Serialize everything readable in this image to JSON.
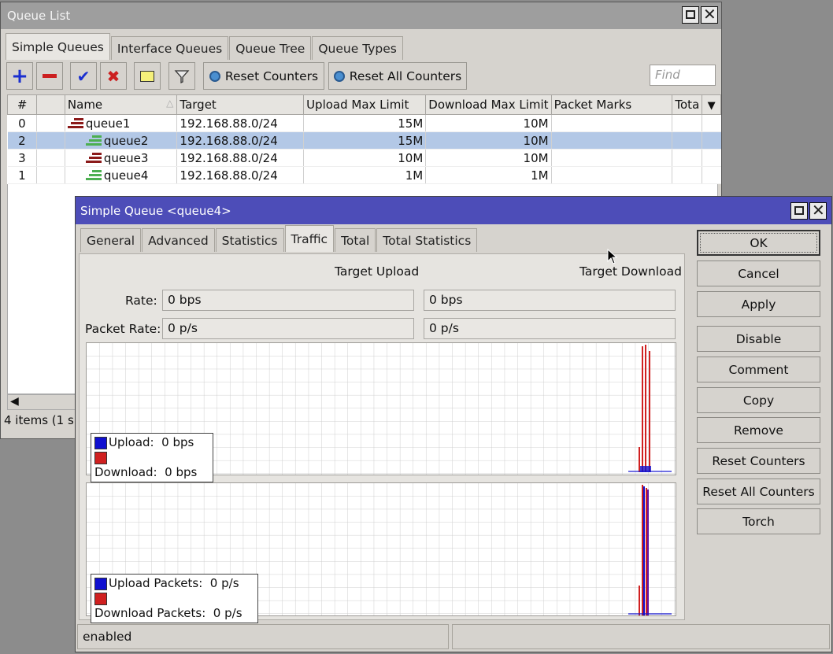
{
  "queue_list": {
    "title": "Queue List",
    "tabs": [
      "Simple Queues",
      "Interface Queues",
      "Queue Tree",
      "Queue Types"
    ],
    "active_tab": 0,
    "toolbar": {
      "reset_counters": "Reset Counters",
      "reset_all_counters": "Reset All Counters",
      "find_placeholder": "Find"
    },
    "columns": [
      "#",
      "",
      "Name",
      "Target",
      "Upload Max Limit",
      "Download Max Limit",
      "Packet Marks",
      "Tota"
    ],
    "rows": [
      {
        "num": "0",
        "name": "queue1",
        "target": "192.168.88.0/24",
        "upload": "15M",
        "download": "10M",
        "icon_color": "#8b1a1a",
        "indent": 0
      },
      {
        "num": "2",
        "name": "queue2",
        "target": "192.168.88.0/24",
        "upload": "15M",
        "download": "10M",
        "icon_color": "#4caf50",
        "indent": 1
      },
      {
        "num": "3",
        "name": "queue3",
        "target": "192.168.88.0/24",
        "upload": "10M",
        "download": "10M",
        "icon_color": "#8b1a1a",
        "indent": 1
      },
      {
        "num": "1",
        "name": "queue4",
        "target": "192.168.88.0/24",
        "upload": "1M",
        "download": "1M",
        "icon_color": "#4caf50",
        "indent": 1
      }
    ],
    "status": "4 items (1 s"
  },
  "simple_queue": {
    "title": "Simple Queue <queue4>",
    "tabs": [
      "General",
      "Advanced",
      "Statistics",
      "Traffic",
      "Total",
      "Total Statistics"
    ],
    "active_tab": 3,
    "col_upload": "Target Upload",
    "col_download": "Target Download",
    "rate_label": "Rate:",
    "rate_upload": "0 bps",
    "rate_download": "0 bps",
    "packet_rate_label": "Packet Rate:",
    "packet_rate_upload": "0 p/s",
    "packet_rate_download": "0 p/s",
    "legend_traffic": {
      "upload": "Upload:  0 bps",
      "download": "Download:  0 bps"
    },
    "legend_packets": {
      "upload": "Upload Packets:  0 p/s",
      "download": "Download Packets:  0 p/s"
    },
    "buttons": [
      "OK",
      "Cancel",
      "Apply",
      "Disable",
      "Comment",
      "Copy",
      "Remove",
      "Reset Counters",
      "Reset All Counters",
      "Torch"
    ],
    "status": "enabled",
    "colors": {
      "upload": "#1010d0",
      "download": "#d02020",
      "title_bar": "#4d4db8"
    }
  }
}
